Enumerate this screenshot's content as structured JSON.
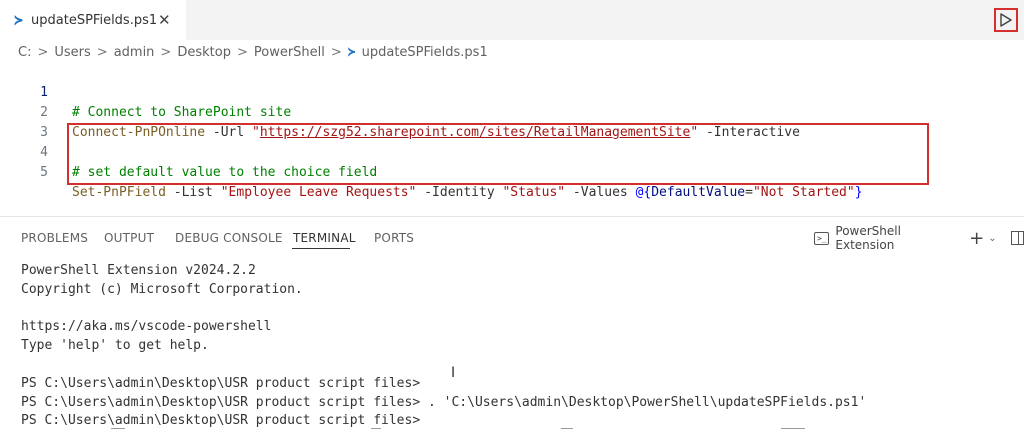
{
  "tab": {
    "icon": "powershell-icon",
    "label": "updateSPFields.ps1",
    "close": "✕"
  },
  "run_button": {
    "icon": "run-icon",
    "highlight_color": "#d32f2f"
  },
  "breadcrumb": {
    "items": [
      "C:",
      "Users",
      "admin",
      "Desktop",
      "PowerShell",
      "updateSPFields.ps1"
    ],
    "separator": ">"
  },
  "editor": {
    "line_numbers": [
      "1",
      "2",
      "3",
      "4",
      "5"
    ],
    "line1": {
      "comment": "# Connect to SharePoint site"
    },
    "line2": {
      "cmd": "Connect-PnPOnline",
      "param1": " -Url ",
      "quote_open": "\"",
      "url": "https://szg52.sharepoint.com/sites/RetailManagementSite",
      "quote_close": "\"",
      "param2": " -Interactive"
    },
    "line3": "",
    "line4": {
      "comment": "# set default value to the choice field"
    },
    "line5": {
      "cmd": "Set-PnPField",
      "p1": " -List ",
      "s1": "\"Employee Leave Requests\"",
      "p2": " -Identity ",
      "s2": "\"Status\"",
      "p3": " -Values ",
      "brace_open": "@{",
      "key": "DefaultValue",
      "eq": "=",
      "s3": "\"Not Started\"",
      "brace_close": "}"
    },
    "highlight_color": "#d32f2f"
  },
  "panel": {
    "tabs": [
      "PROBLEMS",
      "OUTPUT",
      "DEBUG CONSOLE",
      "TERMINAL",
      "PORTS"
    ],
    "active_tab": "TERMINAL",
    "terminal_name": "PowerShell Extension",
    "new_terminal": "+",
    "dropdown": "⌄"
  },
  "terminal": {
    "lines": [
      "PowerShell Extension v2024.2.2",
      "Copyright (c) Microsoft Corporation.",
      "",
      "https://aka.ms/vscode-powershell",
      "Type 'help' to get help.",
      "",
      "PS C:\\Users\\admin\\Desktop\\USR product script files>",
      "PS C:\\Users\\admin\\Desktop\\USR product script files> . 'C:\\Users\\admin\\Desktop\\PowerShell\\updateSPFields.ps1'",
      "PS C:\\Users\\admin\\Desktop\\USR product script files>"
    ]
  },
  "mouse_cursor": "I"
}
